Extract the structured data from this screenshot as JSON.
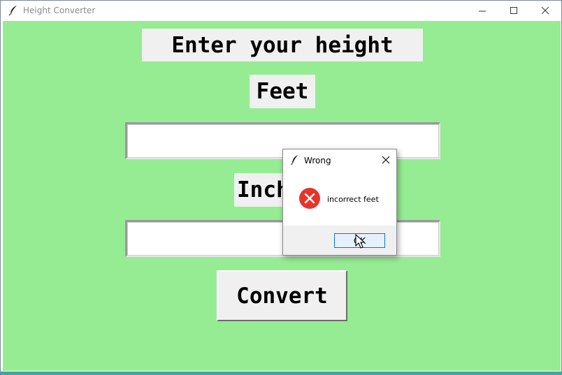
{
  "window": {
    "title": "Height Converter"
  },
  "form": {
    "heading": "Enter your height",
    "feet_label": "Feet",
    "feet_value": "",
    "inches_label": "Inches",
    "inches_value": "",
    "convert_label": "Convert"
  },
  "dialog": {
    "title": "Wrong",
    "message": "incorrect feet",
    "ok_label": "OK"
  },
  "colors": {
    "client_background": "#96ec93",
    "label_background": "#f0f0f0",
    "error_icon": "#e5352a",
    "focus_border": "#0078d7"
  },
  "icons": {
    "app": "feather-icon",
    "minimize": "minimize-icon",
    "maximize": "maximize-icon",
    "close": "close-icon",
    "dialog_close": "close-icon",
    "error": "error-icon",
    "cursor": "cursor-icon"
  }
}
